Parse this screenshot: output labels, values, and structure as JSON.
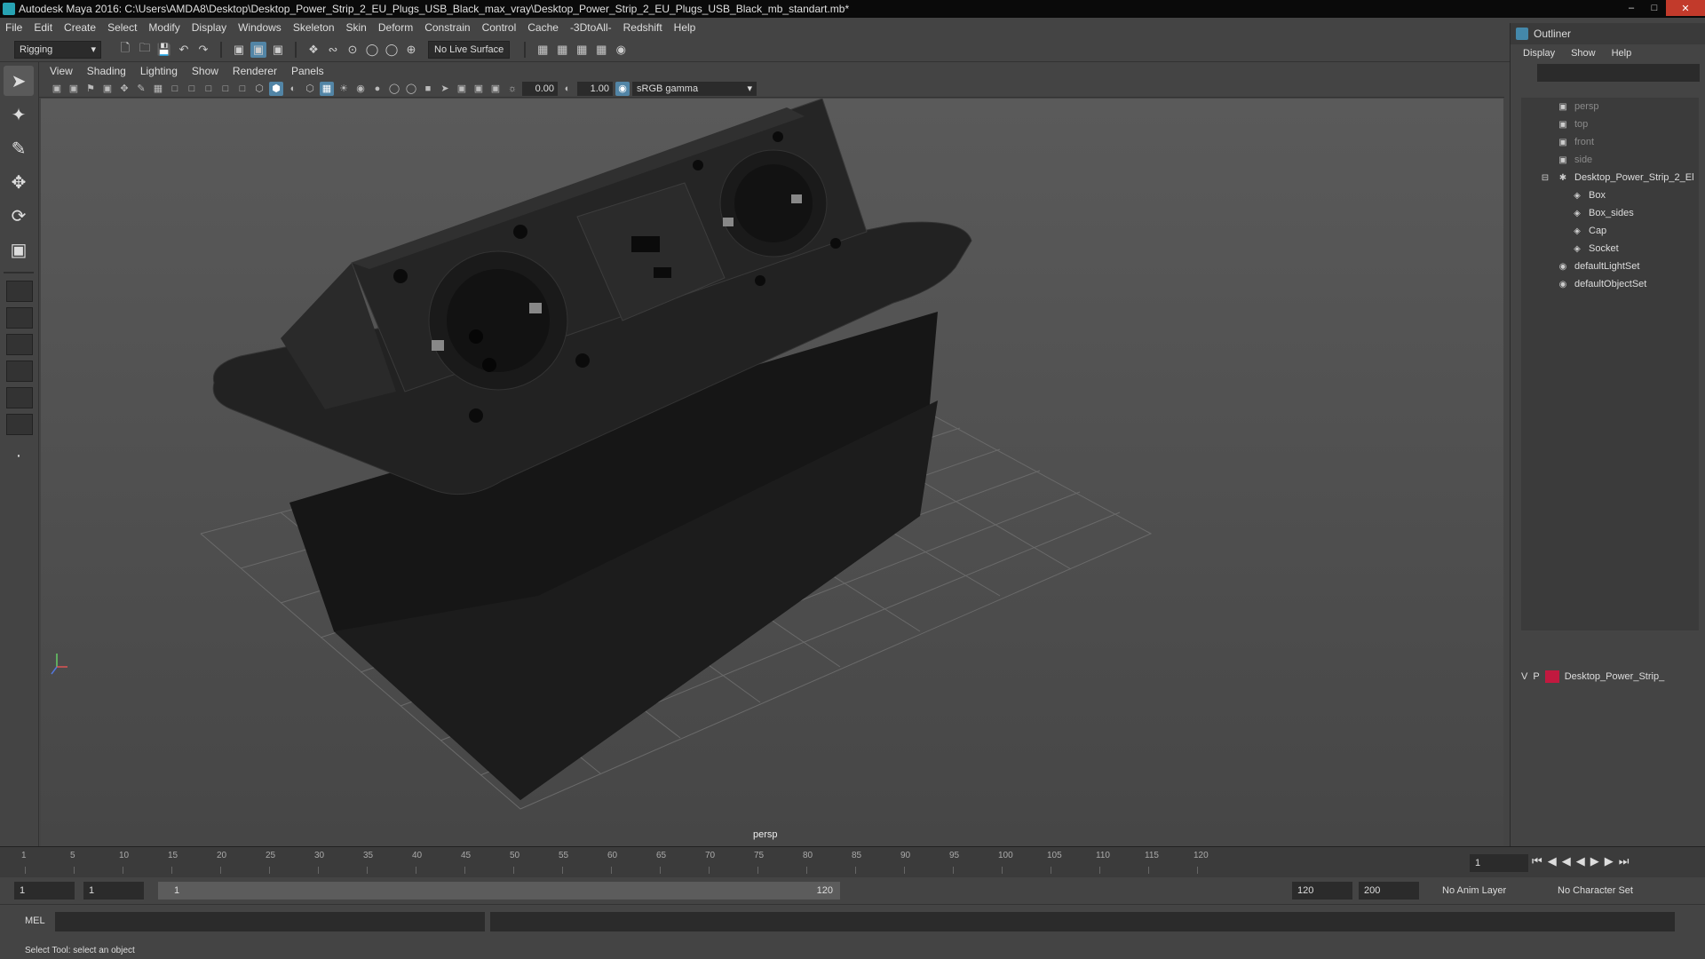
{
  "window": {
    "title": "Autodesk Maya 2016: C:\\Users\\AMDA8\\Desktop\\Desktop_Power_Strip_2_EU_Plugs_USB_Black_max_vray\\Desktop_Power_Strip_2_EU_Plugs_USB_Black_mb_standart.mb*"
  },
  "menubar": [
    "File",
    "Edit",
    "Create",
    "Select",
    "Modify",
    "Display",
    "Windows",
    "Skeleton",
    "Skin",
    "Deform",
    "Constrain",
    "Control",
    "Cache",
    "-3DtoAll-",
    "Redshift",
    "Help"
  ],
  "toolbar": {
    "mode": "Rigging",
    "live_surface": "No Live Surface"
  },
  "panel": {
    "menus": [
      "View",
      "Shading",
      "Lighting",
      "Show",
      "Renderer",
      "Panels"
    ],
    "exposure": "0.00",
    "gamma": "1.00",
    "color_space": "sRGB gamma",
    "camera_label": "persp"
  },
  "outliner": {
    "title": "Outliner",
    "menus": [
      "Display",
      "Show",
      "Help"
    ],
    "items": [
      {
        "label": "persp",
        "icon": "camera-icon",
        "dim": true
      },
      {
        "label": "top",
        "icon": "camera-icon",
        "dim": true
      },
      {
        "label": "front",
        "icon": "camera-icon",
        "dim": true
      },
      {
        "label": "side",
        "icon": "camera-icon",
        "dim": true
      },
      {
        "label": "Desktop_Power_Strip_2_El",
        "icon": "group-icon",
        "dim": false
      },
      {
        "label": "Box",
        "icon": "mesh-icon",
        "dim": false
      },
      {
        "label": "Box_sides",
        "icon": "mesh-icon",
        "dim": false
      },
      {
        "label": "Cap",
        "icon": "mesh-icon",
        "dim": false
      },
      {
        "label": "Socket",
        "icon": "mesh-icon",
        "dim": false
      },
      {
        "label": "defaultLightSet",
        "icon": "set-icon",
        "dim": false
      },
      {
        "label": "defaultObjectSet",
        "icon": "set-icon",
        "dim": false
      }
    ]
  },
  "layers": {
    "v": "V",
    "p": "P",
    "name": "Desktop_Power_Strip_",
    "color": "#c2193f"
  },
  "timeline": {
    "ticks": [
      "1",
      "5",
      "10",
      "15",
      "20",
      "25",
      "30",
      "35",
      "40",
      "45",
      "50",
      "55",
      "60",
      "65",
      "70",
      "75",
      "80",
      "85",
      "90",
      "95",
      "100",
      "105",
      "110",
      "115",
      "120"
    ],
    "current_frame": "1"
  },
  "range": {
    "start": "1",
    "anim_start": "1",
    "slider_start": "1",
    "slider_end": "120",
    "end": "120",
    "anim_end": "200",
    "anim_layer": "No Anim Layer",
    "char_set": "No Character Set"
  },
  "command": {
    "lang": "MEL"
  },
  "status": "Select Tool: select an object"
}
